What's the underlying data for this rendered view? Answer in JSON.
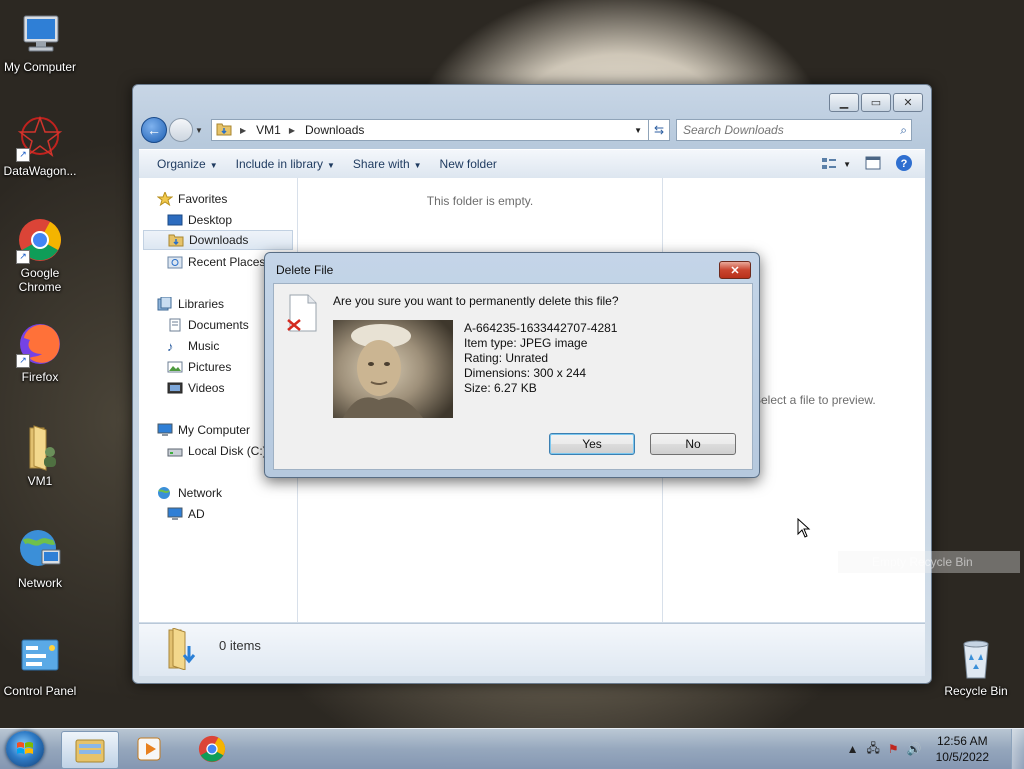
{
  "desktop": {
    "icons": [
      {
        "label": "My Computer"
      },
      {
        "label": "DataWagon..."
      },
      {
        "label": "Google Chrome"
      },
      {
        "label": "Firefox"
      },
      {
        "label": "VM1"
      },
      {
        "label": "Network"
      },
      {
        "label": "Control Panel"
      },
      {
        "label": "Recycle Bin"
      }
    ],
    "ghost_menu_item": "Empty Recycle Bin"
  },
  "explorer": {
    "breadcrumb": [
      "VM1",
      "Downloads"
    ],
    "search_placeholder": "Search Downloads",
    "toolbar": {
      "organize": "Organize",
      "include_in_library": "Include in library",
      "share_with": "Share with",
      "new_folder": "New folder"
    },
    "nav": {
      "favorites": "Favorites",
      "desktop": "Desktop",
      "downloads": "Downloads",
      "recent_places": "Recent Places",
      "libraries": "Libraries",
      "documents": "Documents",
      "music": "Music",
      "pictures": "Pictures",
      "videos": "Videos",
      "my_computer": "My Computer",
      "local_disk": "Local Disk (C:)",
      "network": "Network",
      "ad": "AD"
    },
    "empty_message": "This folder is empty.",
    "preview_message": "Select a file to preview.",
    "item_count": "0 items"
  },
  "dialog": {
    "title": "Delete File",
    "question": "Are you sure you want to permanently delete this file?",
    "file_name": "A-664235-1633442707-4281",
    "item_type": "Item type: JPEG image",
    "rating": "Rating: Unrated",
    "dimensions": "Dimensions: 300 x 244",
    "size": "Size: 6.27 KB",
    "yes_label": "Yes",
    "no_label": "No"
  },
  "taskbar": {
    "time": "12:56 AM",
    "date": "10/5/2022"
  }
}
